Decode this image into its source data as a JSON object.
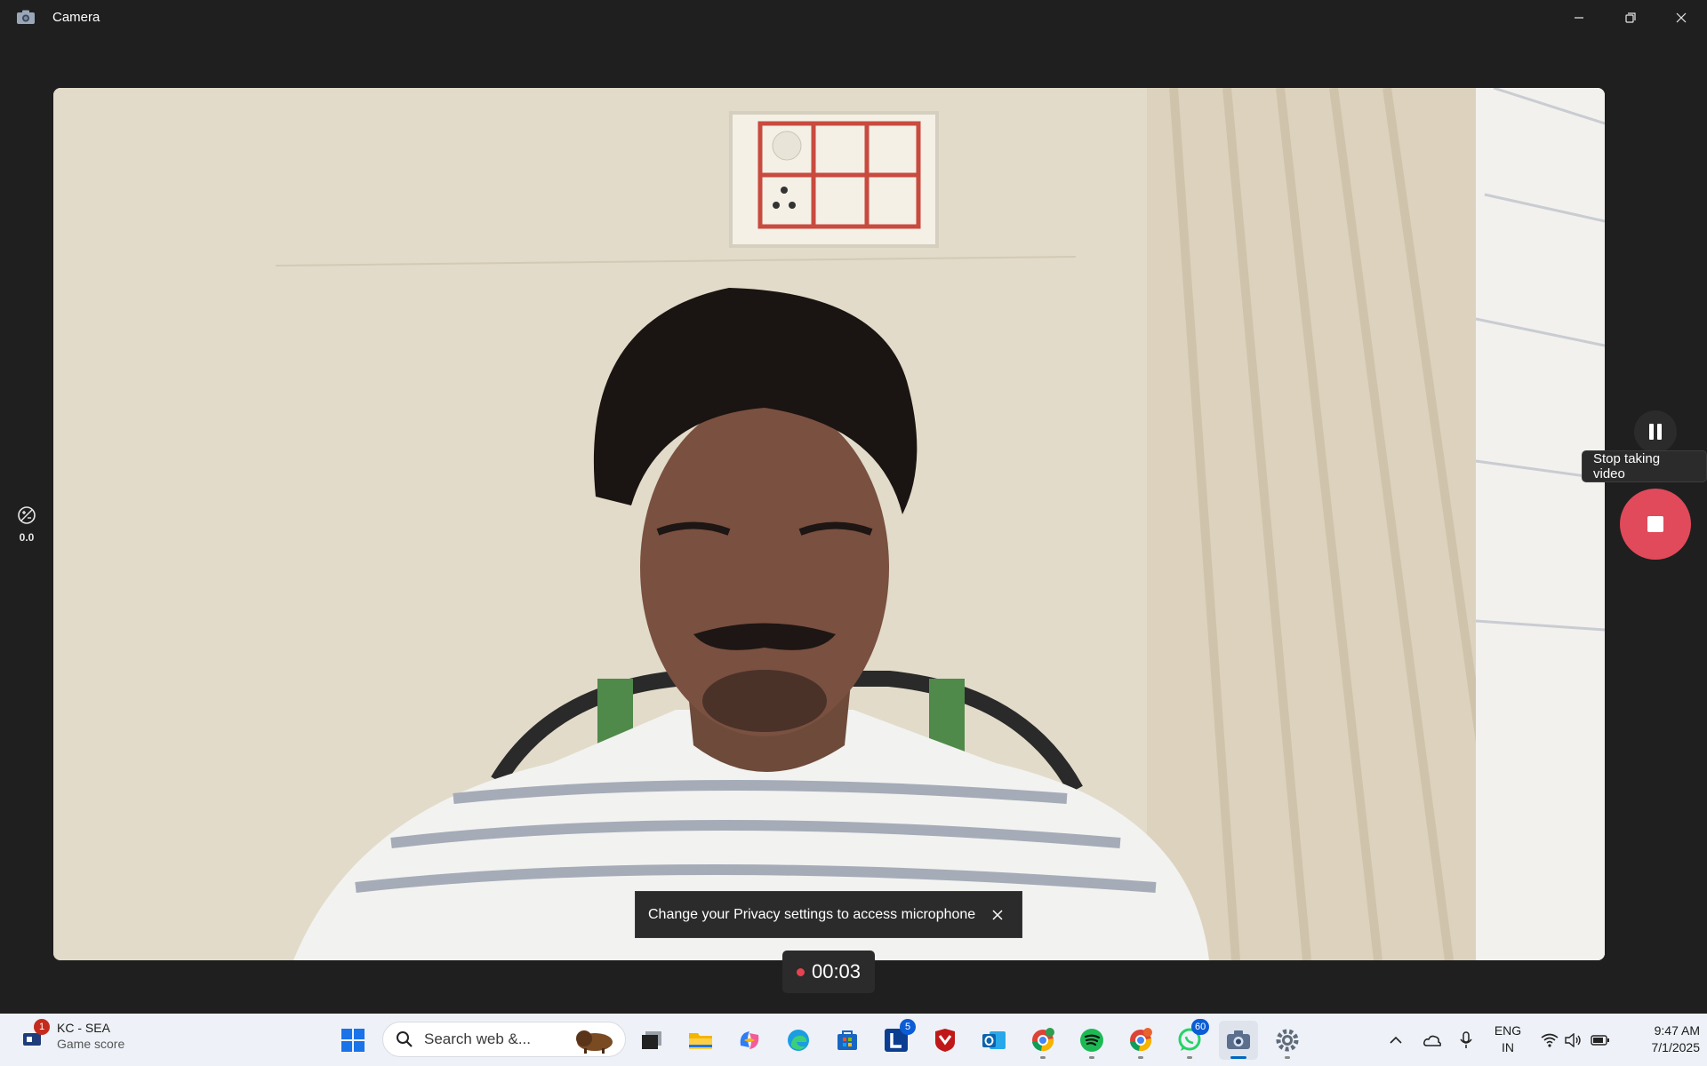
{
  "window": {
    "title": "Camera",
    "controls": [
      "minimize",
      "restore",
      "close"
    ]
  },
  "camera": {
    "exposure_value": "0.0",
    "pause_icon": "pause-icon",
    "tooltip": "Stop taking video",
    "stop_icon": "stop-icon",
    "toast_message": "Change your Privacy settings to access microphone",
    "recording_time": "00:03",
    "accent_color": "#e04a5a"
  },
  "taskbar": {
    "widget": {
      "badge": "1",
      "line1": "KC - SEA",
      "line2": "Game score"
    },
    "search_placeholder": "Search web &...",
    "apps": [
      {
        "name": "start-icon"
      },
      {
        "name": "task-view-icon"
      },
      {
        "name": "file-explorer-icon"
      },
      {
        "name": "copilot-icon"
      },
      {
        "name": "edge-icon"
      },
      {
        "name": "store-icon"
      },
      {
        "name": "l-app-icon",
        "badge": "5"
      },
      {
        "name": "mcafee-icon"
      },
      {
        "name": "outlook-icon"
      },
      {
        "name": "chrome-icon"
      },
      {
        "name": "spotify-icon"
      },
      {
        "name": "chrome-profile-icon"
      },
      {
        "name": "whatsapp-icon",
        "badge": "60"
      },
      {
        "name": "camera-icon"
      },
      {
        "name": "settings-icon"
      }
    ],
    "language_line1": "ENG",
    "language_line2": "IN",
    "time": "9:47 AM",
    "date": "7/1/2025"
  }
}
